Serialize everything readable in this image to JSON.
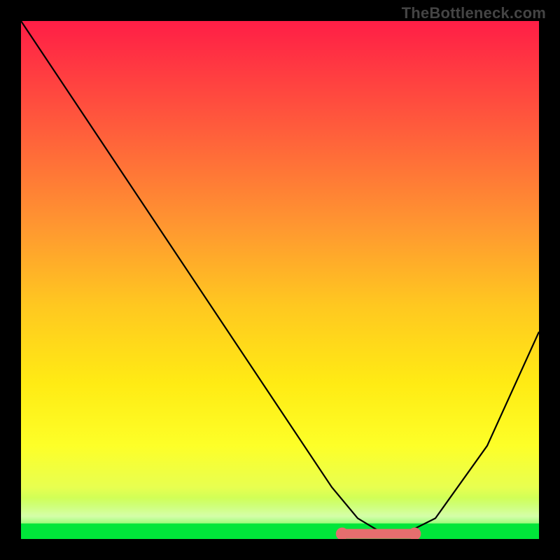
{
  "watermark": "TheBottleneck.com",
  "chart_data": {
    "type": "line",
    "title": "",
    "xlabel": "",
    "ylabel": "",
    "xlim": [
      0,
      100
    ],
    "ylim": [
      0,
      100
    ],
    "grid": false,
    "series": [
      {
        "name": "curve",
        "color": "#000000",
        "x": [
          0,
          10,
          20,
          30,
          40,
          50,
          60,
          65,
          70,
          74,
          80,
          90,
          100
        ],
        "y": [
          100,
          85,
          70,
          55,
          40,
          25,
          10,
          4,
          1,
          1,
          4,
          18,
          40
        ]
      }
    ],
    "flat_band": {
      "name": "green-band",
      "color": "#00E63A",
      "x_start": 0,
      "x_end": 100,
      "y_start": 0,
      "y_end": 3
    },
    "highlight": {
      "name": "minimum-highlight",
      "color": "#E56E6E",
      "x_start": 62,
      "x_end": 76,
      "y": 1
    },
    "gradient_stops": [
      {
        "offset": 0.0,
        "color": "#FF1E46"
      },
      {
        "offset": 0.2,
        "color": "#FF5A3C"
      },
      {
        "offset": 0.4,
        "color": "#FF9830"
      },
      {
        "offset": 0.55,
        "color": "#FFC820"
      },
      {
        "offset": 0.7,
        "color": "#FFEB14"
      },
      {
        "offset": 0.82,
        "color": "#FDFF28"
      },
      {
        "offset": 0.9,
        "color": "#E8FF50"
      },
      {
        "offset": 0.95,
        "color": "#B0FF60"
      },
      {
        "offset": 0.98,
        "color": "#60F850"
      },
      {
        "offset": 1.0,
        "color": "#00E63A"
      }
    ]
  }
}
